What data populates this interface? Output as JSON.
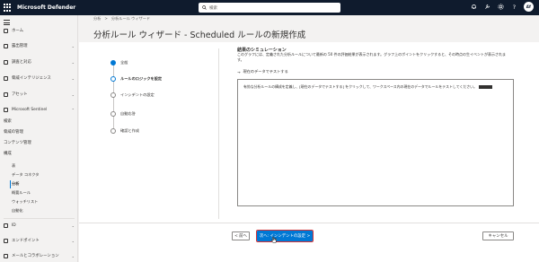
{
  "header": {
    "app_title": "Microsoft Defender",
    "search_placeholder": "検索",
    "avatar_initials": "AY"
  },
  "sidebar": {
    "items": [
      {
        "label": "ホーム"
      },
      {
        "label": "露出管理"
      },
      {
        "label": "調査と対応"
      },
      {
        "label": "脅威インテリジェンス"
      },
      {
        "label": "アセット"
      },
      {
        "label": "Microsoft Sentinel"
      }
    ],
    "plain": [
      "検索",
      "脅威の管理",
      "コンテンツ管理",
      "構成"
    ],
    "sub": [
      "表",
      "データ コネクタ",
      "分析",
      "概要ルール",
      "ウォッチリスト",
      "自動化"
    ],
    "bottom": [
      {
        "label": "ID"
      },
      {
        "label": "エンドポイント"
      },
      {
        "label": "メールとコラボレーション"
      }
    ]
  },
  "breadcrumb": [
    "分析",
    "分析ルール ウィザード"
  ],
  "page_title": "分析ルール ウィザード - Scheduled ルールの新規作成",
  "steps": [
    {
      "label": "全般",
      "state": "done"
    },
    {
      "label": "ルールのロジックを設定",
      "state": "current"
    },
    {
      "label": "インシデントの設定",
      "state": "todo"
    },
    {
      "label": "自動応答",
      "state": "todo"
    },
    {
      "label": "確認と作成",
      "state": "todo"
    }
  ],
  "simulation": {
    "title": "結果のシミュレーション",
    "description": "このグラフには、定義された分析ルールについて最新の 50 件の評価結果が表示されます。グラフ上のポイントをクリックすると、その時点の生イベントが表示されます。",
    "test_link": "現在のデータでテストする",
    "box_text": "有効な分析ルールの構成を定義し、[現在のデータでテストする] をクリックして、ワークスペース内の現在のデータでルールをテストしてください。"
  },
  "footer": {
    "back_label": "< 前へ",
    "next_label": "次へ: インシデントの設定 >",
    "cancel_label": "キャンセル"
  },
  "colors": {
    "topbar": "#0f1b2d",
    "accent": "#0078d4",
    "highlight": "#d13438"
  }
}
